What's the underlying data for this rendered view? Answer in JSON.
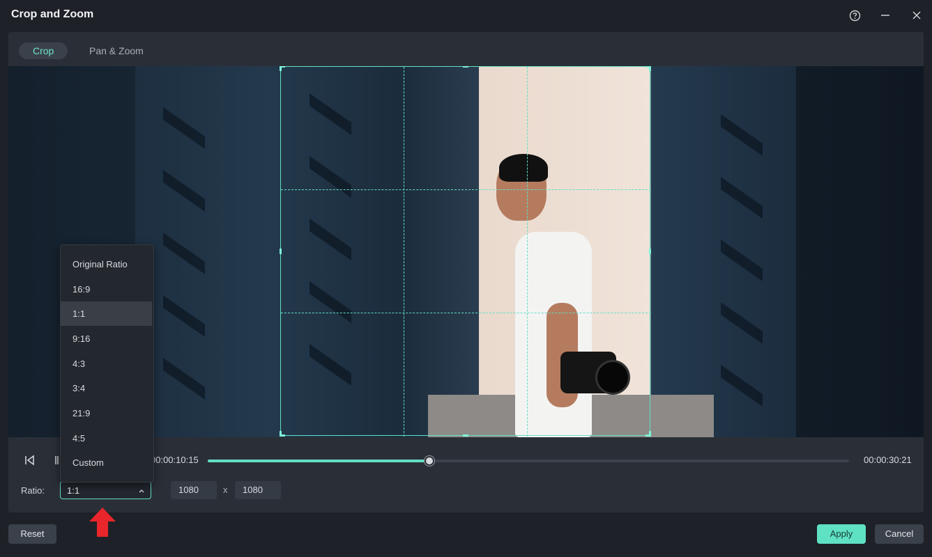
{
  "window": {
    "title": "Crop and Zoom",
    "help_icon": "help-circle-icon",
    "minimize_icon": "minimize-icon",
    "close_icon": "close-icon"
  },
  "tabs": [
    {
      "label": "Crop",
      "active": true
    },
    {
      "label": "Pan & Zoom",
      "active": false
    }
  ],
  "playback": {
    "current_time": "00:00:10:15",
    "total_time": "00:00:30:21",
    "progress": 0.346,
    "prev_frame_icon": "prev-frame-icon",
    "next_frame_icon": "next-frame-icon"
  },
  "ratio": {
    "label": "Ratio:",
    "selected": "1:1",
    "width": "1080",
    "separator": "x",
    "height": "1080",
    "options": [
      "Original Ratio",
      "16:9",
      "1:1",
      "9:16",
      "4:3",
      "3:4",
      "21:9",
      "4:5",
      "Custom"
    ]
  },
  "footer": {
    "reset_label": "Reset",
    "apply_label": "Apply",
    "cancel_label": "Cancel"
  },
  "colors": {
    "accent": "#62dfc4",
    "panel": "#2a2f37",
    "background": "#1e2127",
    "annotation_arrow": "#e8262b"
  }
}
